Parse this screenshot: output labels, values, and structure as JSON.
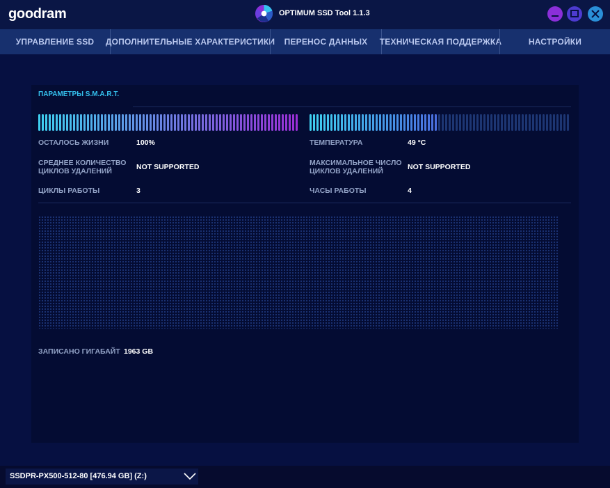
{
  "window": {
    "brand": "goodram",
    "app_title": "OPTIMUM SSD Tool 1.1.3",
    "buttons": {
      "minimize": "minimize-icon",
      "maximize": "maximize-icon",
      "close": "close-icon"
    }
  },
  "nav": {
    "tabs": [
      {
        "label": "УПРАВЛЕНИЕ SSD"
      },
      {
        "label": "ДОПОЛНИТЕЛЬНЫЕ ХАРАКТЕРИСТИКИ"
      },
      {
        "label": "ПЕРЕНОС ДАННЫХ"
      },
      {
        "label": "ТЕХНИЧЕСКАЯ ПОДДЕРЖКА"
      },
      {
        "label": "НАСТРОЙКИ"
      }
    ]
  },
  "smart": {
    "title": "ПАРАМЕТРЫ S.M.A.R.T.",
    "life_meter_fraction": 1.0,
    "temp_meter_fraction": 0.49,
    "life_label": "ОСТАЛОСЬ ЖИЗНИ",
    "life_value": "100%",
    "temp_label": "ТЕМПЕРАТУРА",
    "temp_value": "49 °C",
    "avg_erase_label_1": "СРЕДНЕЕ КОЛИЧЕСТВО",
    "avg_erase_label_2": "ЦИКЛОВ УДАЛЕНИЙ",
    "avg_erase_value": "NOT SUPPORTED",
    "max_erase_label_1": "МАКСИМАЛЬНОЕ ЧИСЛО",
    "max_erase_label_2": "ЦИКЛОВ УДАЛЕНИЙ",
    "max_erase_value": "NOT SUPPORTED",
    "power_cycles_label": "ЦИКЛЫ РАБОТЫ",
    "power_cycles_value": "3",
    "power_hours_label": "ЧАСЫ РАБОТЫ",
    "power_hours_value": "4",
    "written_label": "ЗАПИСАНО ГИГАБАЙТ",
    "written_value": "1963 GB"
  },
  "drive": {
    "selected": "SSDPR-PX500-512-80 [476.94 GB] (Z:)"
  },
  "colors": {
    "accent_cyan": "#35c2ef",
    "meter_start": "#3fd0f0",
    "meter_end": "#9a2fd6",
    "meter_inactive": "#1d3673"
  }
}
